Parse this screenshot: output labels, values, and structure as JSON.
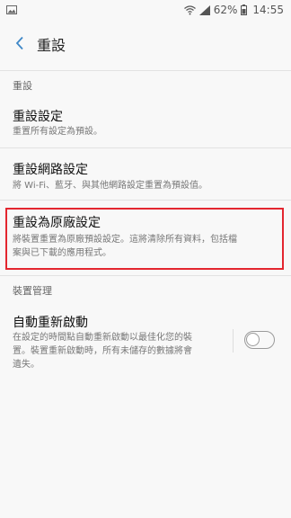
{
  "status_bar": {
    "battery": "62%",
    "time": "14:55",
    "icons": [
      "image-icon",
      "wifi-icon",
      "cell-signal-icon",
      "battery-icon"
    ]
  },
  "app_bar": {
    "title": "重設",
    "back_icon": "back-arrow-icon"
  },
  "sections": {
    "reset_header": "重設",
    "device_header": "裝置管理"
  },
  "items": {
    "reset_settings": {
      "title": "重設設定",
      "subtitle": "重置所有設定為預設。"
    },
    "reset_network": {
      "title": "重設網路設定",
      "subtitle": "將 Wi-Fi、藍牙、與其他網路設定重置為預設值。"
    },
    "factory_reset": {
      "title": "重設為原廠設定",
      "subtitle_line1": "將裝置重置為原廠預設設定。這將清除所有資料，包括檔",
      "subtitle_line2": "案與已下載的應用程式。"
    },
    "auto_restart": {
      "title": "自動重新啟動",
      "subtitle_line1": "在設定的時間點自動重新啟動以最佳化您的裝",
      "subtitle_line2": "置。裝置重新啟動時，所有未儲存的數據將會",
      "subtitle_line3": "遺失。",
      "toggle_on": false
    }
  },
  "colors": {
    "accent": "#3e87c7",
    "highlight": "#e3262f",
    "background": "#f8f8f8"
  }
}
